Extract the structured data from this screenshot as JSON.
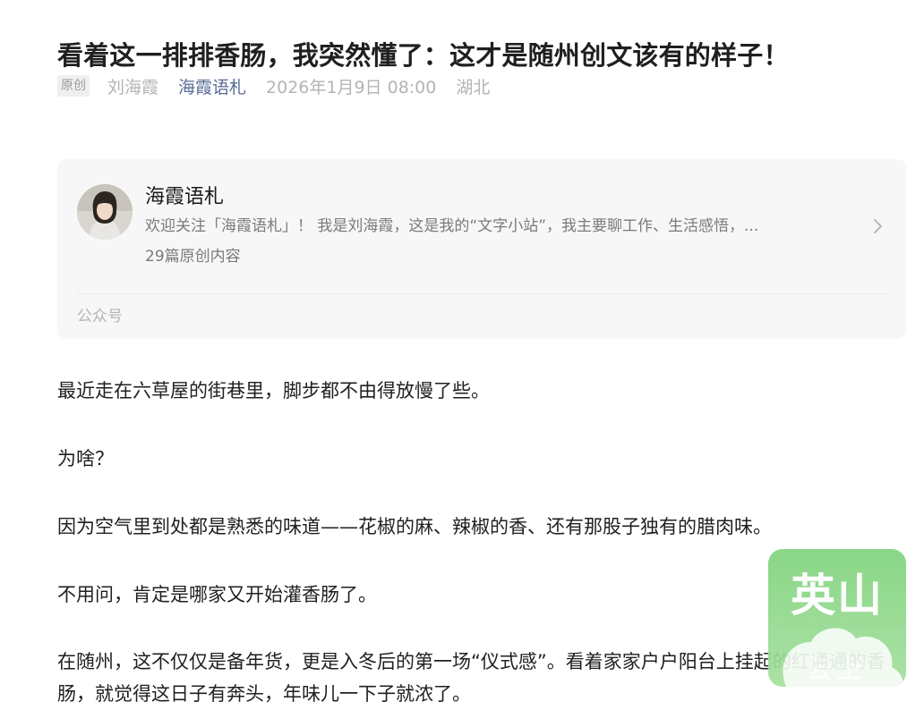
{
  "article": {
    "title": "看着这一排排香肠，我突然懂了：这才是随州创文该有的样子！",
    "meta": {
      "original_tag": "原创",
      "author": "刘海霞",
      "account": "海霞语札",
      "datetime": "2026年1月9日 08:00",
      "location": "湖北"
    },
    "paragraphs": [
      "最近走在六草屋的街巷里，脚步都不由得放慢了些。",
      "为啥？",
      "因为空气里到处都是熟悉的味道——花椒的麻、辣椒的香、还有那股子独有的腊肉味。",
      "不用问，肯定是哪家又开始灌香肠了。",
      "在随州，这不仅仅是备年货，更是入冬后的第一场“仪式感”。看着家家户户阳台上挂起的红通通的香肠，就觉得这日子有奔头，年味儿一下子就浓了。"
    ]
  },
  "profile_card": {
    "name": "海霞语札",
    "description": "欢迎关注「海霞语札」！ 我是刘海霞，这是我的“文字小站”，我主要聊工作、生活感悟，...",
    "article_count": "29篇原创内容",
    "footer_label": "公众号",
    "avatar_icon": "profile-photo",
    "arrow_icon": "chevron-right-icon"
  },
  "floating_badge": {
    "text": "英山",
    "subtext": "云上",
    "icon": "cloud-icon",
    "color": "#7fd37c"
  },
  "colors": {
    "link": "#576b95",
    "meta_gray": "#b4b4b4",
    "card_bg": "#f7f7f7"
  }
}
